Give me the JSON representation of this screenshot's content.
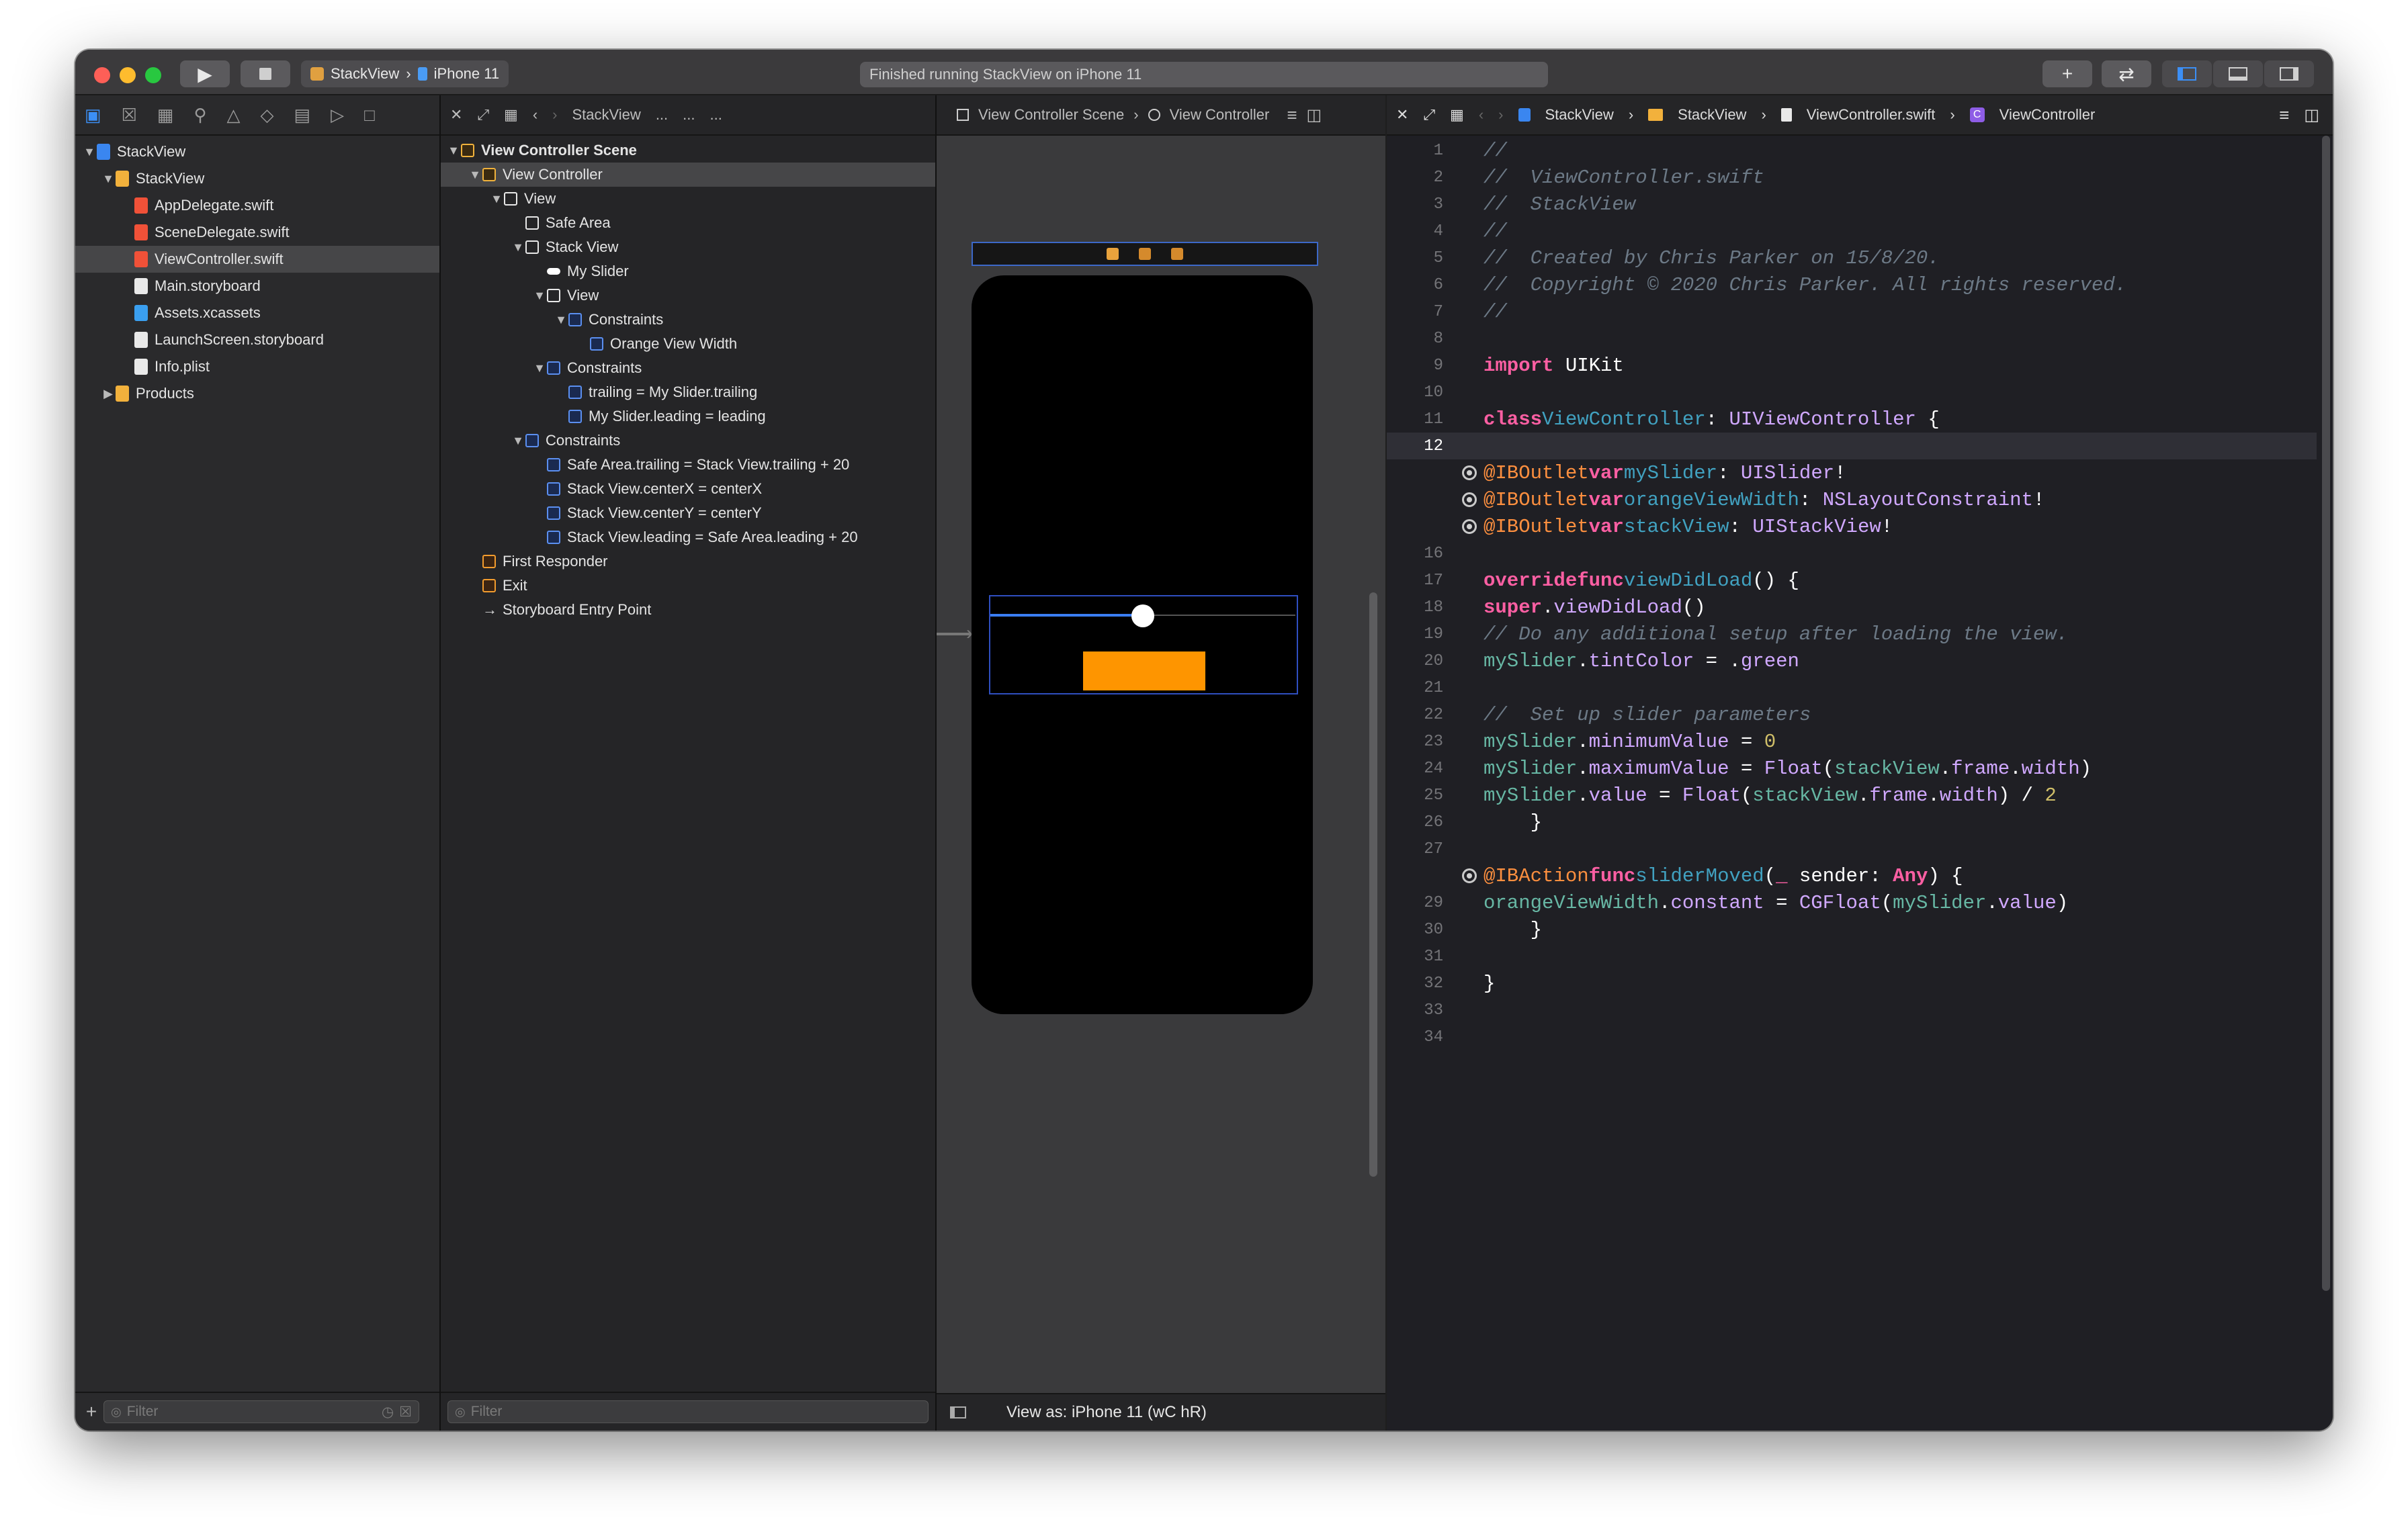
{
  "titlebar": {
    "scheme_target": "StackView",
    "scheme_device": "iPhone 11",
    "activity": "Finished running StackView on iPhone 11"
  },
  "navigator": {
    "icons": [
      "folder-icon",
      "source-control-icon",
      "symbol-icon",
      "find-icon",
      "issue-icon",
      "test-icon",
      "debug-icon",
      "breakpoint-icon",
      "report-icon"
    ],
    "tree": [
      {
        "label": "StackView",
        "depth": 0,
        "kind": "project",
        "disclosure": "open"
      },
      {
        "label": "StackView",
        "depth": 1,
        "kind": "folder",
        "disclosure": "open"
      },
      {
        "label": "AppDelegate.swift",
        "depth": 2,
        "kind": "swift"
      },
      {
        "label": "SceneDelegate.swift",
        "depth": 2,
        "kind": "swift"
      },
      {
        "label": "ViewController.swift",
        "depth": 2,
        "kind": "swift",
        "selected": true
      },
      {
        "label": "Main.storyboard",
        "depth": 2,
        "kind": "storyboard"
      },
      {
        "label": "Assets.xcassets",
        "depth": 2,
        "kind": "assets"
      },
      {
        "label": "LaunchScreen.storyboard",
        "depth": 2,
        "kind": "storyboard"
      },
      {
        "label": "Info.plist",
        "depth": 2,
        "kind": "plist"
      },
      {
        "label": "Products",
        "depth": 1,
        "kind": "folder",
        "disclosure": "closed"
      }
    ],
    "filter_placeholder": "Filter"
  },
  "outline": {
    "breadcrumb": [
      "StackView",
      "...",
      "...",
      "..."
    ],
    "rows": [
      {
        "label": "View Controller Scene",
        "depth": 0,
        "disclosure": "open",
        "icon": "scene",
        "bold": true
      },
      {
        "label": "View Controller",
        "depth": 1,
        "disclosure": "open",
        "icon": "vc",
        "selected": true
      },
      {
        "label": "View",
        "depth": 2,
        "disclosure": "open",
        "icon": "view"
      },
      {
        "label": "Safe Area",
        "depth": 3,
        "icon": "safearea"
      },
      {
        "label": "Stack View",
        "depth": 3,
        "disclosure": "open",
        "icon": "stack"
      },
      {
        "label": "My Slider",
        "depth": 4,
        "icon": "slider"
      },
      {
        "label": "View",
        "depth": 4,
        "disclosure": "open",
        "icon": "view"
      },
      {
        "label": "Constraints",
        "depth": 5,
        "disclosure": "open",
        "icon": "constraint"
      },
      {
        "label": "Orange View Width",
        "depth": 6,
        "icon": "constraint"
      },
      {
        "label": "Constraints",
        "depth": 4,
        "disclosure": "open",
        "icon": "constraint"
      },
      {
        "label": "trailing = My Slider.trailing",
        "depth": 5,
        "icon": "constraint"
      },
      {
        "label": "My Slider.leading = leading",
        "depth": 5,
        "icon": "constraint"
      },
      {
        "label": "Constraints",
        "depth": 3,
        "disclosure": "open",
        "icon": "constraint"
      },
      {
        "label": "Safe Area.trailing = Stack View.trailing + 20",
        "depth": 4,
        "icon": "constraint"
      },
      {
        "label": "Stack View.centerX = centerX",
        "depth": 4,
        "icon": "constraint"
      },
      {
        "label": "Stack View.centerY = centerY",
        "depth": 4,
        "icon": "constraint"
      },
      {
        "label": "Stack View.leading = Safe Area.leading + 20",
        "depth": 4,
        "icon": "constraint"
      },
      {
        "label": "First Responder",
        "depth": 1,
        "icon": "responder"
      },
      {
        "label": "Exit",
        "depth": 1,
        "icon": "exit"
      },
      {
        "label": "Storyboard Entry Point",
        "depth": 1,
        "icon": "arrow"
      }
    ],
    "filter_placeholder": "Filter"
  },
  "canvas": {
    "breadcrumb": [
      "View Controller Scene",
      "View Controller"
    ],
    "footer_label": "View as: iPhone 11 (wC hR)",
    "slider_value_fraction": 0.5
  },
  "editor": {
    "breadcrumb": [
      "StackView",
      "StackView",
      "ViewController.swift",
      "ViewController"
    ],
    "current_line": 12,
    "outlet_lines": [
      13,
      14,
      15,
      28
    ]
  },
  "colors": {
    "accent": "#3c8ff5",
    "orange_view": "#fe9500",
    "keyword": "#fc5fa3",
    "comment": "#6c7986"
  }
}
